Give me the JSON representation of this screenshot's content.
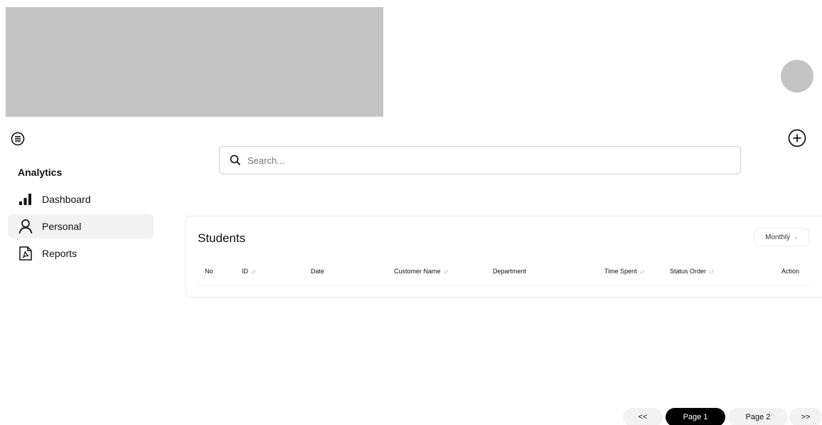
{
  "sidebar": {
    "heading": "Analytics",
    "items": [
      {
        "label": "Dashboard",
        "icon": "bar-chart-icon",
        "active": false
      },
      {
        "label": "Personal",
        "icon": "user-icon",
        "active": true
      },
      {
        "label": "Reports",
        "icon": "pdf-file-icon",
        "active": false
      }
    ]
  },
  "search": {
    "placeholder": "Search...",
    "value": ""
  },
  "table": {
    "title": "Students",
    "period": "Monthly",
    "columns": [
      "No",
      "ID",
      "Date",
      "Customer Name",
      "Department",
      "Time Spent",
      "Status Order",
      "Action"
    ],
    "sort_glyph": "↓↑"
  },
  "pagination": {
    "prev": "<<",
    "pages": [
      "Page 1",
      "Page 2"
    ],
    "next": ">>",
    "current": "Page 1"
  },
  "colors": {
    "placeholder_block": "#c4c4c4",
    "active_item_bg": "#f3f3f3",
    "active_page_bg": "#000000"
  }
}
